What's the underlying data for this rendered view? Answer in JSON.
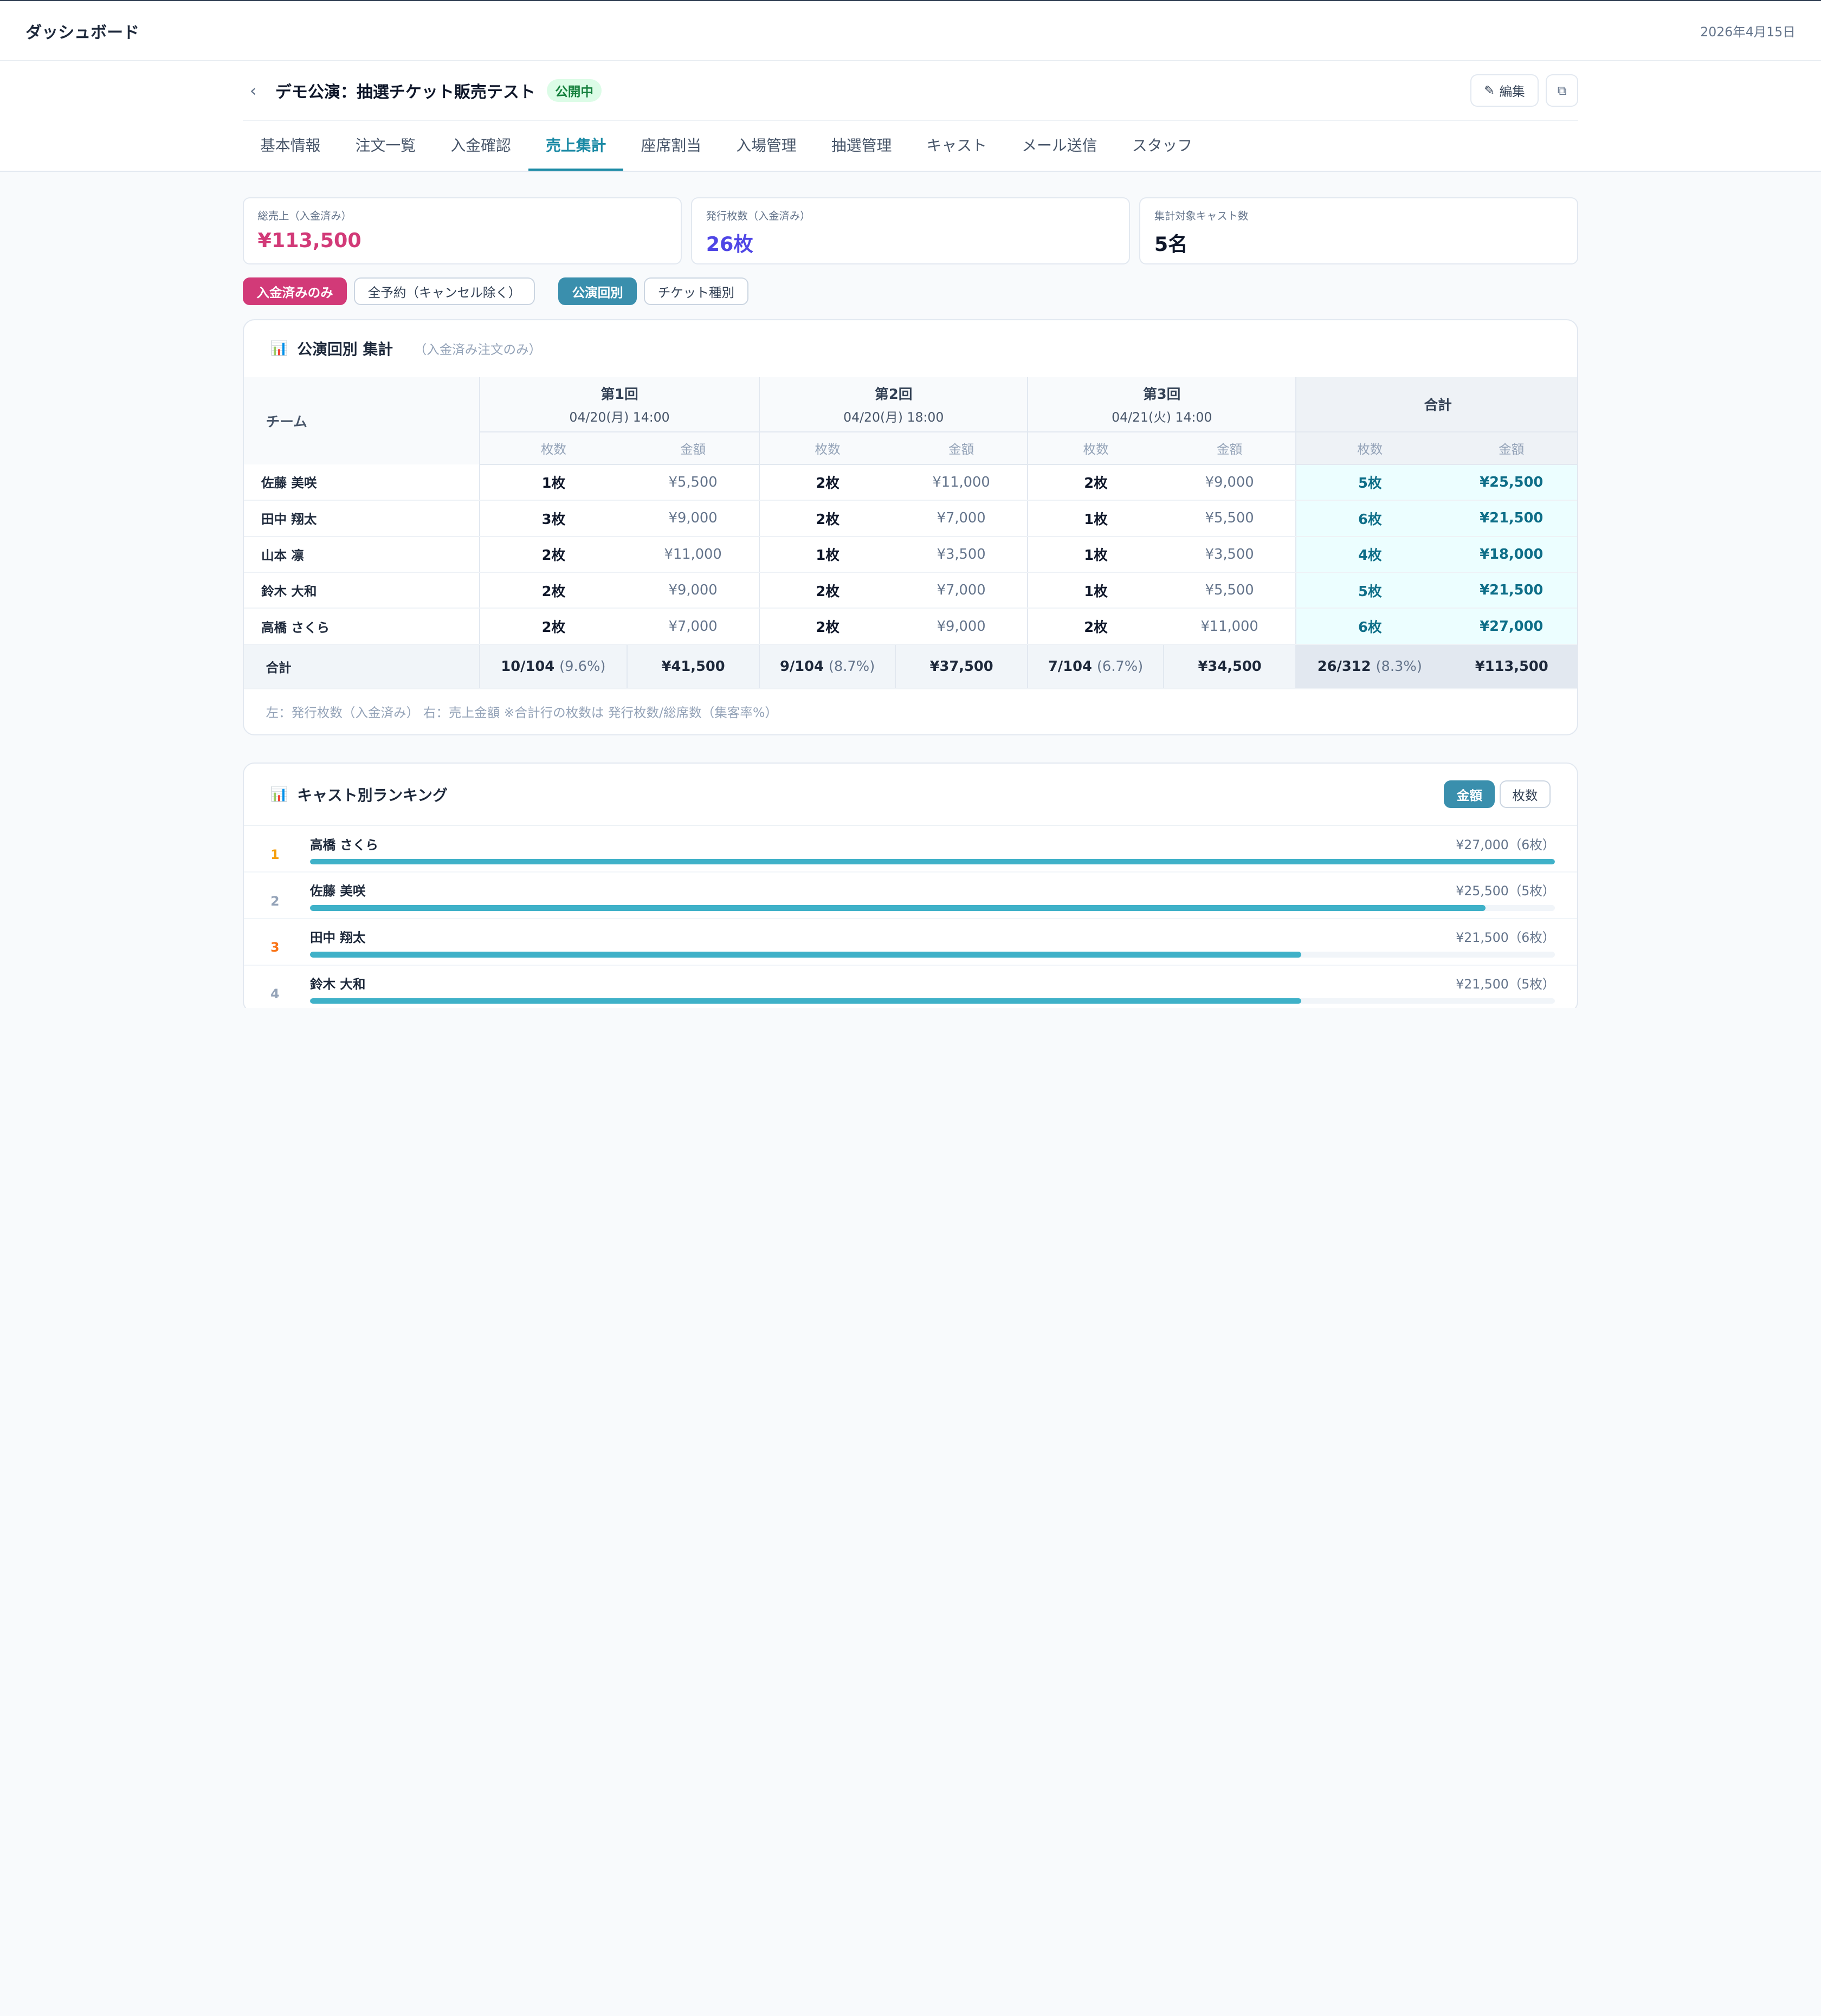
{
  "topbar": {
    "brand": "ダッシュボード",
    "date": "2026年4月15日"
  },
  "event": {
    "title": "デモ公演：抽選チケット販売テスト",
    "status": "公開中",
    "edit_label": "編集"
  },
  "tabs": [
    "基本情報",
    "注文一覧",
    "入金確認",
    "売上集計",
    "座席割当",
    "入場管理",
    "抽選管理",
    "キャスト",
    "メール送信",
    "スタッフ"
  ],
  "active_tab": "売上集計",
  "stats": [
    {
      "label": "総売上（入金済み）",
      "value": "¥113,500"
    },
    {
      "label": "発行枚数（入金済み）",
      "value": "26枚"
    },
    {
      "label": "集計対象キャスト数",
      "value": "5名"
    }
  ],
  "filters": {
    "scope": [
      "入金済みのみ",
      "全予約（キャンセル除く）"
    ],
    "view": [
      "公演回別",
      "チケット種別"
    ]
  },
  "session_table": {
    "title": "公演回別 集計",
    "subtitle": "（入金済み注文のみ）",
    "team_header": "チーム",
    "sessions": [
      {
        "name": "第1回",
        "date": "04/20(月) 14:00"
      },
      {
        "name": "第2回",
        "date": "04/20(月) 18:00"
      },
      {
        "name": "第3回",
        "date": "04/21(火) 14:00"
      }
    ],
    "total_header": "合計",
    "count_header": "枚数",
    "amount_header": "金額",
    "rows": [
      {
        "name": "佐藤 美咲",
        "cells": [
          "1枚",
          "¥5,500",
          "2枚",
          "¥11,000",
          "2枚",
          "¥9,000"
        ],
        "total": [
          "5枚",
          "¥25,500"
        ]
      },
      {
        "name": "田中 翔太",
        "cells": [
          "3枚",
          "¥9,000",
          "2枚",
          "¥7,000",
          "1枚",
          "¥5,500"
        ],
        "total": [
          "6枚",
          "¥21,500"
        ]
      },
      {
        "name": "山本 凛",
        "cells": [
          "2枚",
          "¥11,000",
          "1枚",
          "¥3,500",
          "1枚",
          "¥3,500"
        ],
        "total": [
          "4枚",
          "¥18,000"
        ]
      },
      {
        "name": "鈴木 大和",
        "cells": [
          "2枚",
          "¥9,000",
          "2枚",
          "¥7,000",
          "1枚",
          "¥5,500"
        ],
        "total": [
          "5枚",
          "¥21,500"
        ]
      },
      {
        "name": "高橋 さくら",
        "cells": [
          "2枚",
          "¥7,000",
          "2枚",
          "¥9,000",
          "2枚",
          "¥11,000"
        ],
        "total": [
          "6枚",
          "¥27,000"
        ]
      }
    ],
    "footer": {
      "label": "合計",
      "cells": [
        {
          "count": "10/104",
          "pct": "(9.6%)",
          "amount": "¥41,500"
        },
        {
          "count": "9/104",
          "pct": "(8.7%)",
          "amount": "¥37,500"
        },
        {
          "count": "7/104",
          "pct": "(6.7%)",
          "amount": "¥34,500"
        }
      ],
      "total": {
        "count": "26/312",
        "pct": "(8.3%)",
        "amount": "¥113,500"
      }
    },
    "note": "左：発行枚数（入金済み） 右：売上金額 ※合計行の枚数は 発行枚数/総席数（集客率%）"
  },
  "ranking": {
    "title": "キャスト別ランキング",
    "toggle": [
      "金額",
      "枚数"
    ],
    "items": [
      {
        "rank": "1",
        "name": "高橋 さくら",
        "value": "¥27,000（6枚）",
        "fraction": 1.0,
        "color": "gold"
      },
      {
        "rank": "2",
        "name": "佐藤 美咲",
        "value": "¥25,500（5枚）",
        "fraction": 0.944,
        "color": "gray"
      },
      {
        "rank": "3",
        "name": "田中 翔太",
        "value": "¥21,500（6枚）",
        "fraction": 0.796,
        "color": "bronze"
      },
      {
        "rank": "4",
        "name": "鈴木 大和",
        "value": "¥21,500（5枚）",
        "fraction": 0.796,
        "color": "gray"
      }
    ]
  }
}
